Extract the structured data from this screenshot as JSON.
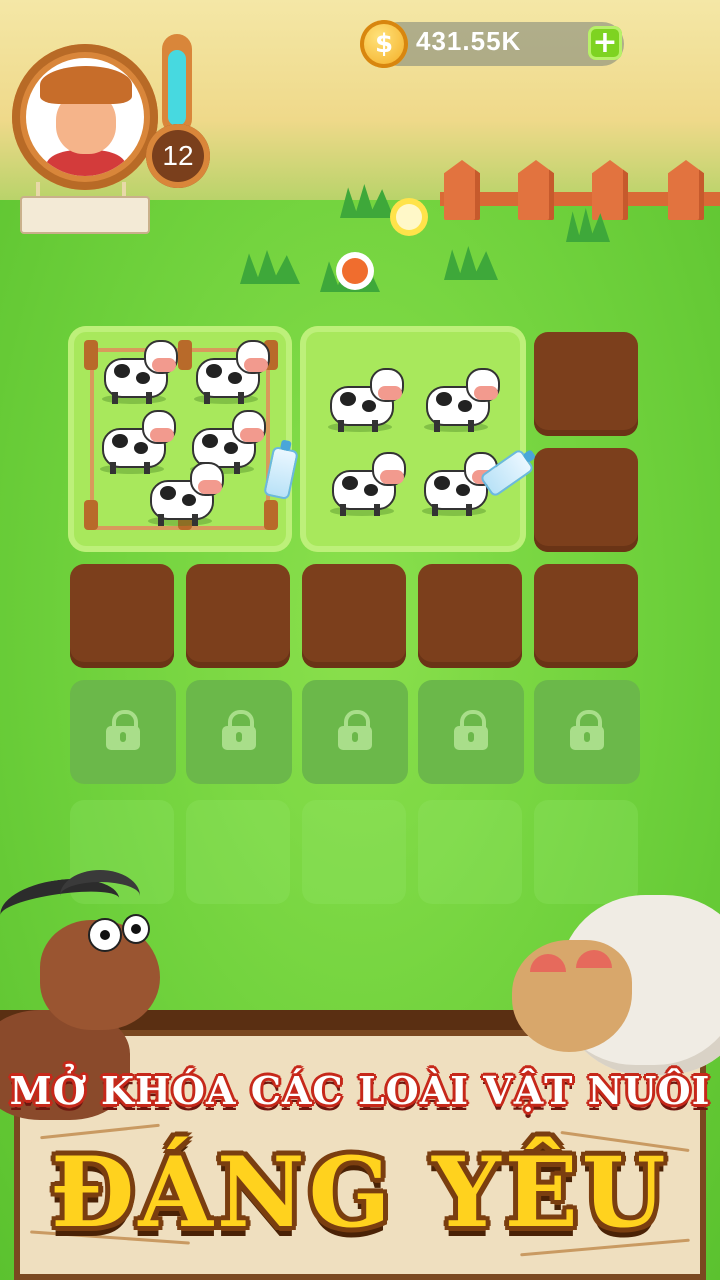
{
  "hud": {
    "player_level": "12",
    "xp_progress": 0.9,
    "coins": "431.55K",
    "coin_symbol": "$",
    "add_label": "+"
  },
  "grid": {
    "columns": 5,
    "pens": [
      {
        "animal": "cow",
        "count": 5,
        "fenced": true,
        "has_milk": true
      },
      {
        "animal": "cow",
        "count": 4,
        "fenced": false,
        "has_milk": true
      }
    ],
    "empty_soil_slots": 7,
    "locked_slots": 5
  },
  "banner": {
    "line1": "MỞ KHÓA CÁC LOÀI VẬT NUÔI",
    "line2": "ĐÁNG YÊU"
  },
  "colors": {
    "grass": "#6fd13c",
    "soil": "#7c3f1c",
    "locked": "#6bb84a",
    "coin": "#f3a81c",
    "accent_red": "#c6281a",
    "gold_text": "#ffd21e"
  },
  "icons": [
    "coin-icon",
    "plus-icon",
    "lock-icon",
    "milk-bottle-icon"
  ]
}
